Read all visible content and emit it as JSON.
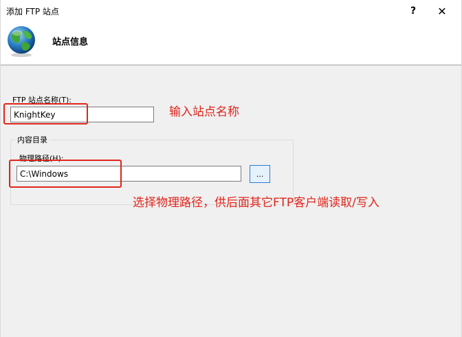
{
  "window": {
    "title": "添加 FTP 站点",
    "help_label": "?",
    "close_label": "✕"
  },
  "header": {
    "title": "站点信息",
    "icon": "globe-icon"
  },
  "form": {
    "site_name_label": "FTP 站点名称(T):",
    "site_name_value": "KnightKey",
    "content_group_label": "内容目录",
    "physical_path_label": "物理路径(H):",
    "physical_path_value": "C:\\Windows",
    "browse_label": "..."
  },
  "annotations": {
    "site_name_note": "输入站点名称",
    "path_note": "选择物理路径，供后面其它FTP客户端读取/写入"
  },
  "colors": {
    "annotation_red": "#e0241a",
    "accent_blue": "#2e7bd6"
  }
}
